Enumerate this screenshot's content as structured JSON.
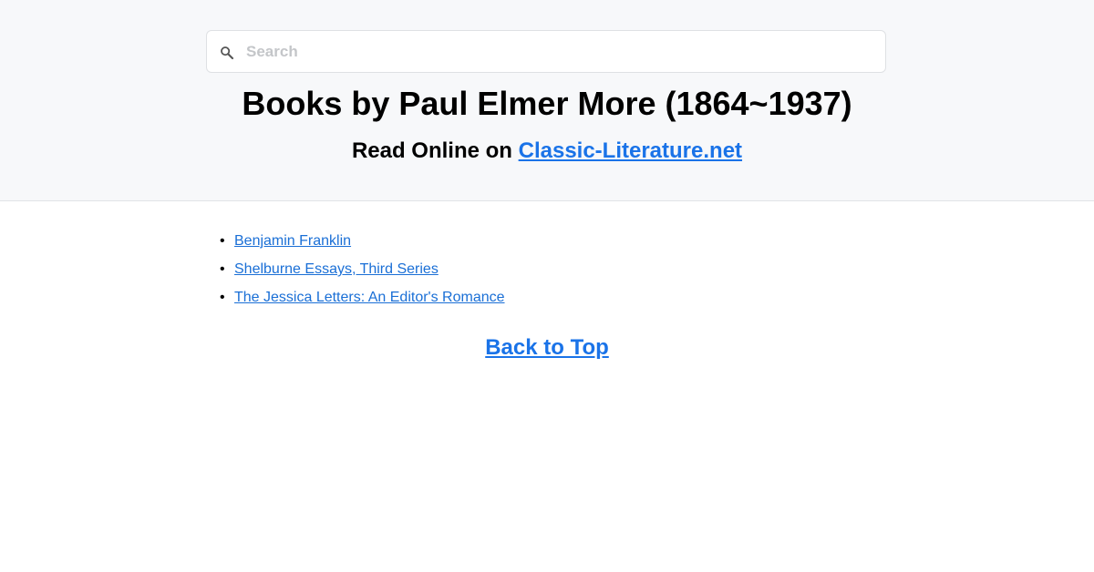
{
  "search": {
    "placeholder": "Search",
    "icon": "search-icon"
  },
  "header": {
    "title": "Books by Paul Elmer More (1864~1937)",
    "subtitle_prefix": "Read Online on ",
    "site_link": "Classic-Literature.net"
  },
  "books": [
    {
      "title": "Benjamin Franklin"
    },
    {
      "title": "Shelburne Essays, Third Series"
    },
    {
      "title": "The Jessica Letters: An Editor's Romance"
    }
  ],
  "footer": {
    "back_to_top": "Back to Top"
  },
  "colors": {
    "header_bg": "#f7f8fa",
    "link": "#1a73e8"
  }
}
